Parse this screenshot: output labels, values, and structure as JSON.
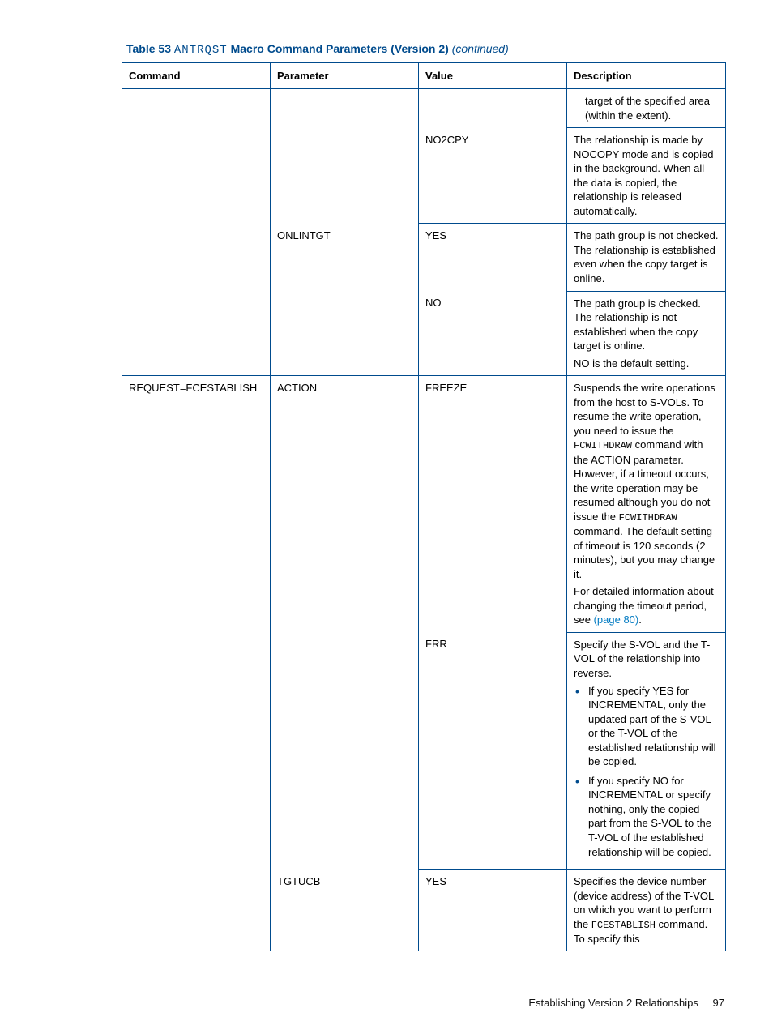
{
  "caption": {
    "prefix": "Table 53 ",
    "mono": "ANTRQST",
    "rest": " Macro Command Parameters (Version 2) ",
    "continued": "(continued)"
  },
  "headers": {
    "c1": "Command",
    "c2": "Parameter",
    "c3": "Value",
    "c4": "Description"
  },
  "rows": {
    "r0": {
      "desc": "target of the specified area (within the extent)."
    },
    "r1": {
      "value": "NO2CPY",
      "desc": "The relationship is made by NOCOPY mode and is copied in the background. When all the data is copied, the relationship is released automatically."
    },
    "r2": {
      "param": "ONLINTGT",
      "value": "YES",
      "desc": "The path group is not checked. The relationship is established even when the copy target is online."
    },
    "r3": {
      "value": "NO",
      "desc_a": "The path group is checked. The relationship is not established when the copy target is online.",
      "desc_b": "NO is the default setting."
    },
    "r4": {
      "command": "REQUEST=FCESTABLISH",
      "param": "ACTION",
      "value": "FREEZE",
      "desc_a1": "Suspends the write operations from the host to S-VOLs. To resume the write operation, you need to issue the ",
      "mono1": "FCWITHDRAW",
      "desc_a2": " command with the ACTION parameter. However, if a timeout occurs, the write operation may be resumed although you do not issue the ",
      "mono2": "FCWITHDRAW",
      "desc_a3": " command. The default setting of timeout is 120 seconds (2 minutes), but you may change it.",
      "desc_b1": "For detailed information about changing the timeout period, see ",
      "linktext": "(page 80)",
      "desc_b2": "."
    },
    "r5": {
      "value": "FRR",
      "desc_intro": "Specify the S-VOL and the T-VOL of the relationship into reverse.",
      "bullet1": "If you specify YES for INCREMENTAL, only the updated part of the S-VOL or the T-VOL of the established relationship will be copied.",
      "bullet2": "If you specify NO for INCREMENTAL or specify nothing, only the copied part from the S-VOL to the T-VOL of the established relationship will be copied."
    },
    "r6": {
      "param": "TGTUCB",
      "value": "YES",
      "desc_a": "Specifies the device number (device address) of the T-VOL on which you want to perform the ",
      "mono": "FCESTABLISH",
      "desc_b": " command. To specify this"
    }
  },
  "footer": {
    "section": "Establishing Version 2 Relationships",
    "pagenum": "97"
  }
}
